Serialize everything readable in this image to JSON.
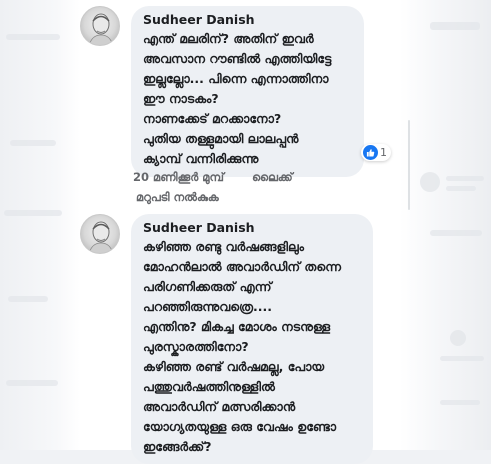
{
  "comments": [
    {
      "author": "Sudheer Danish",
      "lines": [
        "എന്ത് മലരിന്?  അതിന് ഇവർ",
        "അവസാന റൗണ്ടിൽ എത്തിയിട്ടേ",
        "ഇല്ലല്ലോ... പിന്നെ എന്നാത്തിനാ",
        "ഈ നാടകം?",
        "നാണക്കേട് മറക്കാനോ?",
        "പുതിയ തള്ളുമായി ലാലപ്പൻ",
        "ക്യാമ്പ് വന്നിരിക്കുന്നു"
      ],
      "reaction_count": "1",
      "time": "20 മണിക്കൂർ മുമ്പ്",
      "like_label": "ലൈക്ക്",
      "reply_label": "മറുപടി നൽകുക"
    },
    {
      "author": "Sudheer Danish",
      "lines": [
        "കഴിഞ്ഞ രണ്ടു വർഷങ്ങളിലും",
        "മോഹൻലാൽ അവാർഡിന് തന്നെ",
        "പരിഗണിക്കരുത് എന്ന്",
        "പറഞ്ഞിരുന്നുവത്രെ....",
        "എന്തിനു?  മികച്ച മോശം നടനുള്ള",
        "പുരസ്കാരത്തിനോ?",
        "കഴിഞ്ഞ രണ്ട് വർഷമല്ല,  പോയ",
        "പത്തുവർഷത്തിനുള്ളിൽ",
        "അവാർഡിന് മത്സരിക്കാൻ",
        "യോഗ്യതയുള്ള ഒരു വേഷം ഉണ്ടോ",
        "ഇങ്ങേർക്ക്?"
      ]
    }
  ],
  "icons": {
    "reaction": "like-thumb-icon",
    "avatar": "profile-avatar"
  },
  "colors": {
    "bubble": "#edf0f4",
    "like_blue": "#1877f2",
    "meta_gray": "#65676b"
  }
}
